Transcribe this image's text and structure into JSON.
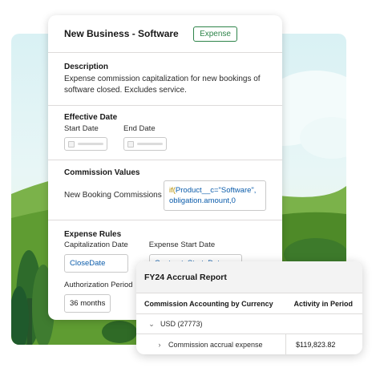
{
  "form": {
    "title": "New Business - Software",
    "status_badge": "Expense",
    "description": {
      "heading": "Description",
      "text": "Expense commission capitalization for new bookings of software closed. Excludes service."
    },
    "effective_date": {
      "heading": "Effective Date",
      "start_label": "Start Date",
      "end_label": "End Date"
    },
    "commission_values": {
      "heading": "Commission Values",
      "row_label": "New Booking Commissions",
      "formula_fn": "if(",
      "formula_line1_rest": "Product__c=\"Software\",",
      "formula_line2": "obligation.amount,0"
    },
    "expense_rules": {
      "heading": "Expense Rules",
      "cap_date_label": "Capitalization Date",
      "cap_date_value": "CloseDate",
      "start_date_label": "Expense Start Date",
      "start_date_value": "Contract_Start_Date__c",
      "auth_period_label": "Authorization Period",
      "auth_period_value": "36 months"
    }
  },
  "report": {
    "title": "FY24 Accrual Report",
    "col_category": "Commission Accounting by Currency",
    "col_activity": "Activity in Period",
    "rows": [
      {
        "label": "USD (27773)",
        "icon": "chevron-down-icon"
      },
      {
        "label": "Commission accrual expense",
        "value": "$119,823.82",
        "icon": "chevron-right-icon"
      }
    ]
  },
  "colors": {
    "badge_green": "#2e844a",
    "link_blue": "#0b5cab",
    "formula_fn": "#b58e00"
  }
}
